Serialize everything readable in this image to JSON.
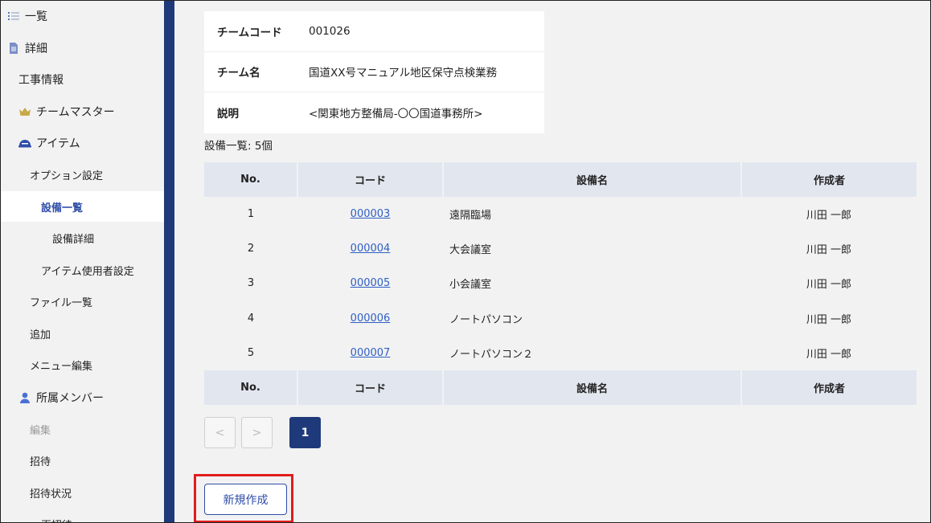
{
  "sidebar": {
    "items": [
      {
        "label": "一覧",
        "icon": "list-icon"
      },
      {
        "label": "詳細",
        "icon": "document-icon"
      },
      {
        "label": "工事情報"
      },
      {
        "label": "チームマスター",
        "icon": "crown-icon"
      },
      {
        "label": "アイテム",
        "icon": "helmet-icon"
      },
      {
        "label": "オプション設定"
      },
      {
        "label": "設備一覧",
        "active": true
      },
      {
        "label": "設備詳細"
      },
      {
        "label": "アイテム使用者設定"
      },
      {
        "label": "ファイル一覧"
      },
      {
        "label": "追加"
      },
      {
        "label": "メニュー編集"
      },
      {
        "label": "所属メンバー",
        "icon": "user-icon"
      },
      {
        "label": "編集",
        "muted": true
      },
      {
        "label": "招待"
      },
      {
        "label": "招待状況"
      },
      {
        "label": "再招待"
      }
    ]
  },
  "team_info": {
    "code_label": "チームコード",
    "code_value": "001026",
    "name_label": "チーム名",
    "name_value": "国道XX号マニュアル地区保守点検業務",
    "desc_label": "説明",
    "desc_value": "<関東地方整備局-〇〇国道事務所>"
  },
  "equipment": {
    "count_label": "設備一覧: 5個",
    "headers": {
      "no": "No.",
      "code": "コード",
      "name": "設備名",
      "author": "作成者"
    },
    "rows": [
      {
        "no": "1",
        "code": "000003",
        "name": "遠隔臨場",
        "author": "川田 一郎"
      },
      {
        "no": "2",
        "code": "000004",
        "name": "大会議室",
        "author": "川田 一郎"
      },
      {
        "no": "3",
        "code": "000005",
        "name": "小会議室",
        "author": "川田 一郎"
      },
      {
        "no": "4",
        "code": "000006",
        "name": "ノートパソコン",
        "author": "川田 一郎"
      },
      {
        "no": "5",
        "code": "000007",
        "name": "ノートパソコン２",
        "author": "川田 一郎"
      }
    ]
  },
  "pagination": {
    "prev": "<",
    "next": ">",
    "current": "1"
  },
  "actions": {
    "new_label": "新規作成"
  },
  "colors": {
    "accent": "#1f3a7a",
    "link": "#2f5fc4",
    "highlight": "#e11d1d"
  }
}
